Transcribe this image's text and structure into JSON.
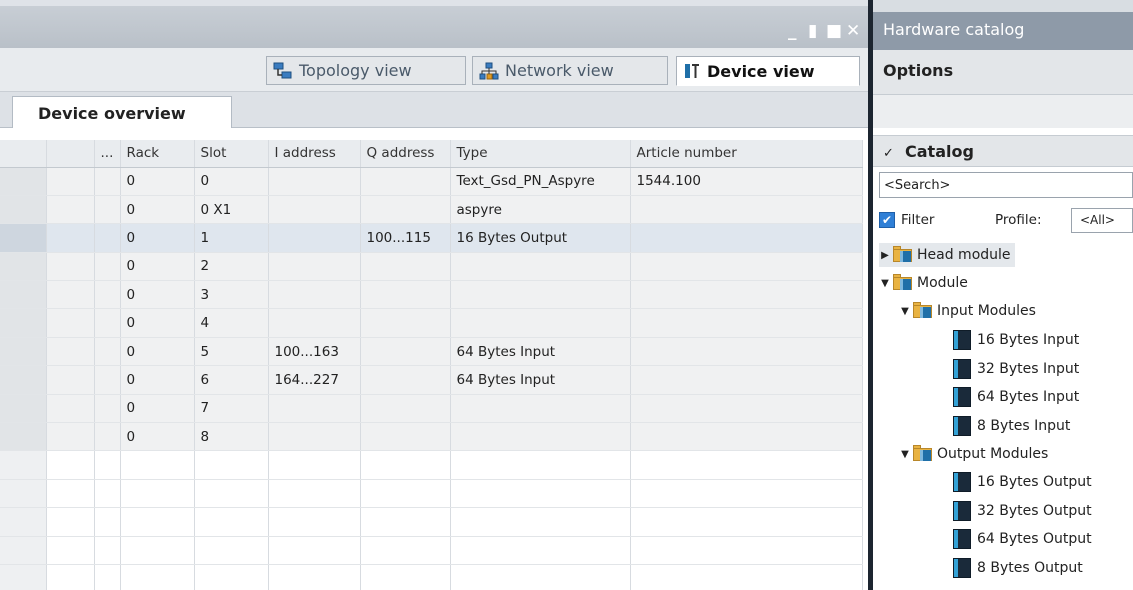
{
  "window_controls": {
    "minimize": "_",
    "restore": "▮",
    "maximize": "■",
    "close": "✕"
  },
  "views": {
    "topology": "Topology view",
    "network": "Network view",
    "device": "Device view"
  },
  "overview_tab": "Device overview",
  "table": {
    "headers": [
      "",
      "",
      "...",
      "Rack",
      "Slot",
      "I address",
      "Q address",
      "Type",
      "Article number"
    ],
    "rows": [
      {
        "rack": "0",
        "slot": "0",
        "i_address": "",
        "q_address": "",
        "type": "Text_Gsd_PN_Aspyre",
        "article": "1544.100"
      },
      {
        "rack": "0",
        "slot": "0 X1",
        "i_address": "",
        "q_address": "",
        "type": "aspyre",
        "article": ""
      },
      {
        "rack": "0",
        "slot": "1",
        "i_address": "",
        "q_address": "100...115",
        "type": "16 Bytes Output",
        "article": ""
      },
      {
        "rack": "0",
        "slot": "2",
        "i_address": "",
        "q_address": "",
        "type": "",
        "article": ""
      },
      {
        "rack": "0",
        "slot": "3",
        "i_address": "",
        "q_address": "",
        "type": "",
        "article": ""
      },
      {
        "rack": "0",
        "slot": "4",
        "i_address": "",
        "q_address": "",
        "type": "",
        "article": ""
      },
      {
        "rack": "0",
        "slot": "5",
        "i_address": "100...163",
        "q_address": "",
        "type": "64 Bytes Input",
        "article": ""
      },
      {
        "rack": "0",
        "slot": "6",
        "i_address": "164...227",
        "q_address": "",
        "type": "64 Bytes Input",
        "article": ""
      },
      {
        "rack": "0",
        "slot": "7",
        "i_address": "",
        "q_address": "",
        "type": "",
        "article": ""
      },
      {
        "rack": "0",
        "slot": "8",
        "i_address": "",
        "q_address": "",
        "type": "",
        "article": ""
      }
    ],
    "selected_row": 2,
    "empty_rows": 5
  },
  "catalog": {
    "title": "Hardware catalog",
    "options": "Options",
    "section": "Catalog",
    "search_placeholder": "<Search>",
    "filter_label": "Filter",
    "filter_checked": true,
    "profile_label": "Profile:",
    "profile_value": "<All>",
    "tree": {
      "head_module": "Head module",
      "module": "Module",
      "input_modules": "Input Modules",
      "inputs": [
        "16 Bytes Input",
        "32 Bytes Input",
        "64 Bytes Input",
        "8 Bytes Input"
      ],
      "output_modules": "Output Modules",
      "outputs": [
        "16 Bytes Output",
        "32 Bytes Output",
        "64 Bytes Output",
        "8 Bytes Output"
      ]
    }
  },
  "colors": {
    "splitter": "#1c2530",
    "catalog_header": "#8e9aa8",
    "folder": "#e9b342",
    "module_blue": "#34a2d6",
    "check_blue": "#2f7fd6"
  }
}
